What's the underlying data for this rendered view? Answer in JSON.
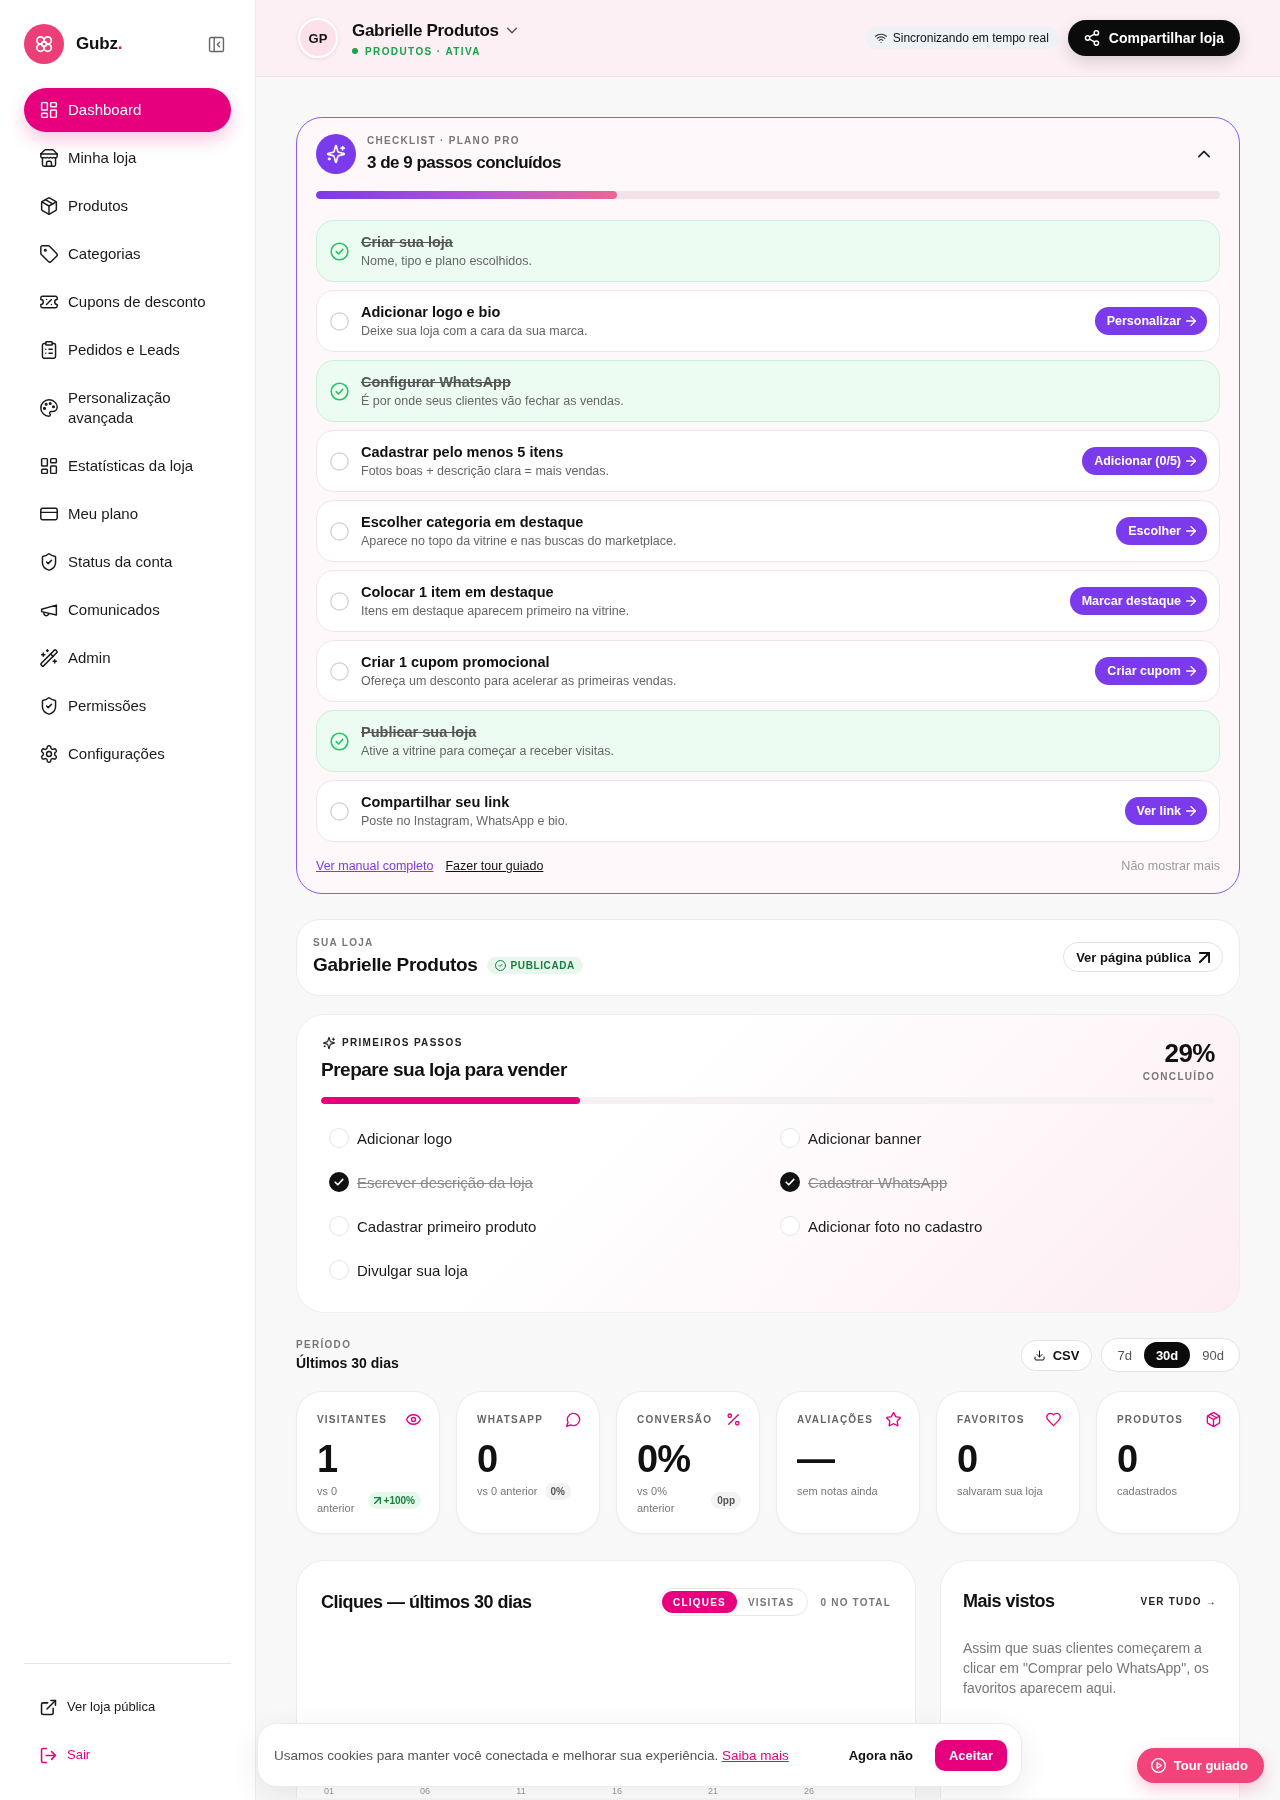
{
  "sidebar": {
    "brand": {
      "name": "Gubz",
      "accent": "."
    },
    "nav": [
      {
        "label": "Dashboard",
        "selected": true
      },
      {
        "label": "Minha loja",
        "selected": false
      },
      {
        "label": "Produtos",
        "selected": false
      },
      {
        "label": "Categorias",
        "selected": false
      },
      {
        "label": "Cupons de desconto",
        "selected": false
      },
      {
        "label": "Pedidos e Leads",
        "selected": false
      },
      {
        "label": "Personalização avançada",
        "selected": false
      },
      {
        "label": "Estatísticas da loja",
        "selected": false
      },
      {
        "label": "Meu plano",
        "selected": false
      },
      {
        "label": "Status da conta",
        "selected": false
      },
      {
        "label": "Comunicados",
        "selected": false
      },
      {
        "label": "Admin",
        "selected": false
      },
      {
        "label": "Permissões",
        "selected": false
      },
      {
        "label": "Configurações",
        "selected": false
      }
    ],
    "footer_links": [
      {
        "label": "Ver loja pública",
        "kind": "external"
      },
      {
        "label": "Sair",
        "kind": "logout"
      }
    ]
  },
  "header": {
    "avatar": "GP",
    "store_name": "Gabrielle Produtos",
    "status": "PRODUTOS · ATIVA",
    "sync": "Sincronizando em tempo real",
    "share_button": "Compartilhar loja"
  },
  "checklist": {
    "eyebrow": "CHECKLIST · PLANO PRO",
    "title": "3 de 9 passos concluídos",
    "expanded": true,
    "level": 0.333,
    "steps": [
      {
        "title": "Criar sua loja",
        "description": "Nome, tipo e plano escolhidos.",
        "done": true
      },
      {
        "title": "Adicionar logo e bio",
        "description": "Deixe sua loja com a cara da sua marca.",
        "done": false,
        "action": "Personalizar"
      },
      {
        "title": "Configurar WhatsApp",
        "description": "É por onde seus clientes vão fechar as vendas.",
        "done": true
      },
      {
        "title": "Cadastrar pelo menos 5 itens",
        "description": "Fotos boas + descrição clara = mais vendas.",
        "done": false,
        "action": "Adicionar (0/5)"
      },
      {
        "title": "Escolher categoria em destaque",
        "description": "Aparece no topo da vitrine e nas buscas do marketplace.",
        "done": false,
        "action": "Escolher"
      },
      {
        "title": "Colocar 1 item em destaque",
        "description": "Itens em destaque aparecem primeiro na vitrine.",
        "done": false,
        "action": "Marcar destaque"
      },
      {
        "title": "Criar 1 cupom promocional",
        "description": "Ofereça um desconto para acelerar as primeiras vendas.",
        "done": false,
        "action": "Criar cupom"
      },
      {
        "title": "Publicar sua loja",
        "description": "Ative a vitrine para começar a receber visitas.",
        "done": true
      },
      {
        "title": "Compartilhar seu link",
        "description": "Poste no Instagram, WhatsApp e bio.",
        "done": false,
        "action": "Ver link"
      }
    ],
    "links": [
      {
        "label": "Ver manual completo",
        "kind": "accent"
      },
      {
        "label": "Fazer tour guiado",
        "kind": "plain"
      }
    ],
    "dismiss": "Não mostrar mais"
  },
  "store": {
    "eyebrow": "SUA LOJA",
    "name": "Gabrielle Produtos",
    "badge": "PUBLICADA",
    "button": "Ver página pública"
  },
  "getting_started": {
    "eyebrow": "PRIMEIROS PASSOS",
    "title": "Prepare sua loja para vender",
    "percent": "29%",
    "percent_label": "CONCLUÍDO",
    "level": 0.29,
    "tasks": [
      {
        "label": "Adicionar logo",
        "checked": false
      },
      {
        "label": "Adicionar banner",
        "checked": false
      },
      {
        "label": "Escrever descrição da loja",
        "checked": true
      },
      {
        "label": "Cadastrar WhatsApp",
        "checked": true
      },
      {
        "label": "Cadastrar primeiro produto",
        "checked": false
      },
      {
        "label": "Adicionar foto no cadastro",
        "checked": false
      },
      {
        "label": "Divulgar sua loja",
        "checked": false
      }
    ]
  },
  "period": {
    "label": "PERÍODO",
    "value": "Últimos 30 dias",
    "export_button": "CSV",
    "ranges": [
      {
        "label": "7d",
        "selected": false
      },
      {
        "label": "30d",
        "selected": true
      },
      {
        "label": "90d",
        "selected": false
      }
    ]
  },
  "stats": [
    {
      "label": "VISITANTES",
      "value": "1",
      "caption": "vs 0 anterior",
      "delta": {
        "text": "+100%",
        "kind": "up"
      }
    },
    {
      "label": "WHATSAPP",
      "value": "0",
      "caption": "vs 0 anterior",
      "delta": {
        "text": "0%",
        "kind": "flat"
      }
    },
    {
      "label": "CONVERSÃO",
      "value": "0%",
      "caption": "vs 0% anterior",
      "delta": {
        "text": "0pp",
        "kind": "flat"
      }
    },
    {
      "label": "AVALIAÇÕES",
      "value": "—",
      "caption": "sem notas ainda"
    },
    {
      "label": "FAVORITOS",
      "value": "0",
      "caption": "salvaram sua loja"
    },
    {
      "label": "PRODUTOS",
      "value": "0",
      "caption": "cadastrados"
    }
  ],
  "clicks_chart": {
    "title": "Cliques — últimos 30 dias",
    "metrics": [
      {
        "label": "CLIQUES",
        "selected": true
      },
      {
        "label": "VISITAS",
        "selected": false
      }
    ],
    "total": "0 NO TOTAL",
    "x_labels": [
      "01",
      "06",
      "11",
      "16",
      "21",
      "26"
    ]
  },
  "most_viewed": {
    "title": "Mais vistos",
    "link": "VER TUDO →",
    "empty_text": "Assim que suas clientes começarem a clicar em \"Comprar pelo WhatsApp\", os favoritos aparecem aqui."
  },
  "cookie_banner": {
    "text": "Usamos cookies para manter você conectada e melhorar sua experiência.",
    "link": "Saiba mais",
    "decline": "Agora não",
    "accept": "Aceitar"
  },
  "tour_button": "Tour guiado"
}
